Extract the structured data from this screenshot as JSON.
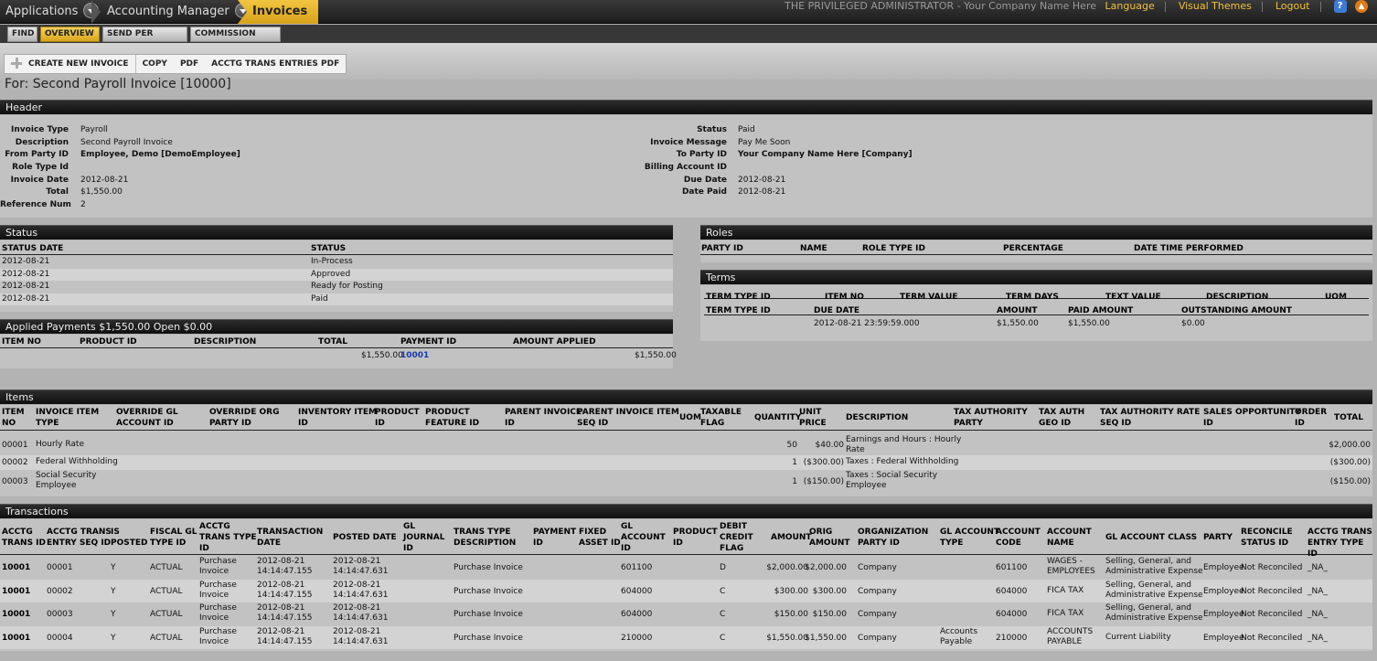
{
  "appbar": {
    "crumb1": "Applications",
    "crumb2": "Accounting Manager",
    "crumb3": "Invoices",
    "admin_text": "THE PRIVILEGED ADMINISTRATOR - Your Company Name Here",
    "language": "Language",
    "themes": "Visual Themes",
    "logout": "Logout",
    "help_icon": "?",
    "warn_icon": "▲"
  },
  "tabs": [
    "FIND",
    "OVERVIEW",
    "SEND PER EMAIL",
    "COMMISSION RUN"
  ],
  "actions": [
    "CREATE NEW INVOICE",
    "COPY",
    "PDF",
    "ACCTG TRANS ENTRIES PDF"
  ],
  "page_title": "For: Second Payroll Invoice [10000]",
  "header": {
    "title": "Header",
    "left": [
      {
        "label": "Invoice Type",
        "value": "Payroll"
      },
      {
        "label": "Description",
        "value": "Second Payroll Invoice"
      },
      {
        "label": "From Party ID",
        "value": "Employee, Demo [DemoEmployee]"
      },
      {
        "label": "Role Type Id",
        "value": ""
      },
      {
        "label": "Invoice Date",
        "value": "2012-08-21"
      },
      {
        "label": "Total",
        "value": "$1,550.00"
      },
      {
        "label": "Reference Num",
        "value": "2"
      }
    ],
    "right": [
      {
        "label": "Status",
        "value": "Paid"
      },
      {
        "label": "Invoice Message",
        "value": "Pay Me Soon"
      },
      {
        "label": "To Party ID",
        "value": "Your Company Name Here [Company]"
      },
      {
        "label": "Billing Account ID",
        "value": ""
      },
      {
        "label": "Due Date",
        "value": "2012-08-21"
      },
      {
        "label": "Date Paid",
        "value": "2012-08-21"
      }
    ]
  },
  "status": {
    "title": "Status",
    "col_date": "STATUS DATE",
    "col_status": "STATUS",
    "rows": [
      {
        "date": "2012-08-21",
        "status": "In-Process"
      },
      {
        "date": "2012-08-21",
        "status": "Approved"
      },
      {
        "date": "2012-08-21",
        "status": "Ready for Posting"
      },
      {
        "date": "2012-08-21",
        "status": "Paid"
      }
    ]
  },
  "applied": {
    "title": "Applied Payments $1,550.00 Open $0.00",
    "cols": [
      "ITEM NO",
      "PRODUCT ID",
      "DESCRIPTION",
      "TOTAL",
      "PAYMENT ID",
      "AMOUNT APPLIED"
    ],
    "row": {
      "total": "$1,550.00",
      "payment_id": "10001",
      "amount_applied": "$1,550.00"
    }
  },
  "roles": {
    "title": "Roles",
    "cols": [
      "PARTY ID",
      "NAME",
      "ROLE TYPE ID",
      "PERCENTAGE",
      "DATE TIME PERFORMED"
    ]
  },
  "terms": {
    "title": "Terms",
    "cols1": [
      "TERM TYPE ID",
      "ITEM NO",
      "TERM VALUE",
      "TERM DAYS",
      "TEXT VALUE",
      "DESCRIPTION",
      "UOM"
    ],
    "cols2": [
      "TERM TYPE ID",
      "DUE DATE",
      "AMOUNT",
      "PAID AMOUNT",
      "OUTSTANDING AMOUNT"
    ],
    "row": {
      "due_date": "2012-08-21 23:59:59.000",
      "amount": "$1,550.00",
      "paid": "$1,550.00",
      "outstanding": "$0.00"
    }
  },
  "items": {
    "title": "Items",
    "cols": [
      [
        "ITEM",
        "NO"
      ],
      [
        "INVOICE ITEM",
        "TYPE"
      ],
      [
        "OVERRIDE GL",
        "ACCOUNT ID"
      ],
      [
        "OVERRIDE ORG",
        "PARTY ID"
      ],
      [
        "INVENTORY ITEM",
        "ID"
      ],
      [
        "PRODUCT",
        "ID"
      ],
      [
        "PRODUCT",
        "FEATURE ID"
      ],
      [
        "PARENT INVOICE",
        "ID"
      ],
      [
        "PARENT INVOICE ITEM",
        "SEQ ID"
      ],
      [
        "UOM",
        ""
      ],
      [
        "TAXABLE",
        "FLAG"
      ],
      [
        "QUANTITY",
        ""
      ],
      [
        "UNIT",
        "PRICE"
      ],
      [
        "DESCRIPTION",
        ""
      ],
      [
        "TAX AUTHORITY",
        "PARTY"
      ],
      [
        "TAX AUTH",
        "GEO ID"
      ],
      [
        "TAX AUTHORITY RATE",
        "SEQ ID"
      ],
      [
        "SALES OPPORTUNITY",
        "ID"
      ],
      [
        "ORDER",
        "ID"
      ],
      [
        "TOTAL",
        ""
      ]
    ],
    "rows": [
      {
        "no": "00001",
        "type": [
          "Hourly Rate"
        ],
        "qty": "50",
        "price": "$40.00",
        "desc": [
          "Earnings and Hours : Hourly",
          "Rate"
        ],
        "total": "$2,000.00"
      },
      {
        "no": "00002",
        "type": [
          "Federal Withholding"
        ],
        "qty": "1",
        "price": "($300.00)",
        "desc": [
          "Taxes : Federal Withholding"
        ],
        "total": "($300.00)"
      },
      {
        "no": "00003",
        "type": [
          "Social Security",
          "Employee"
        ],
        "qty": "1",
        "price": "($150.00)",
        "desc": [
          "Taxes : Social Security",
          "Employee"
        ],
        "total": "($150.00)"
      }
    ]
  },
  "transactions": {
    "title": "Transactions",
    "cols": [
      [
        "ACCTG",
        "TRANS ID"
      ],
      [
        "ACCTG TRANS",
        "ENTRY SEQ ID"
      ],
      [
        "IS",
        "POSTED"
      ],
      [
        "FISCAL GL",
        "TYPE ID"
      ],
      [
        "ACCTG",
        "TRANS TYPE",
        "ID"
      ],
      [
        "TRANSACTION",
        "DATE"
      ],
      [
        "POSTED DATE"
      ],
      [
        "GL",
        "JOURNAL",
        "ID"
      ],
      [
        "TRANS TYPE",
        "DESCRIPTION"
      ],
      [
        "PAYMENT",
        "ID"
      ],
      [
        "FIXED",
        "ASSET ID"
      ],
      [
        "GL",
        "ACCOUNT",
        "ID"
      ],
      [
        "PRODUCT",
        "ID"
      ],
      [
        "DEBIT",
        "CREDIT",
        "FLAG"
      ],
      [
        "AMOUNT"
      ],
      [
        "ORIG",
        "AMOUNT"
      ],
      [
        "ORGANIZATION",
        "PARTY ID"
      ],
      [
        "GL ACCOUNT",
        "TYPE"
      ],
      [
        "ACCOUNT",
        "CODE"
      ],
      [
        "ACCOUNT",
        "NAME"
      ],
      [
        "GL ACCOUNT CLASS"
      ],
      [
        "PARTY"
      ],
      [
        "RECONCILE",
        "STATUS ID"
      ],
      [
        "ACCTG TRANS",
        "ENTRY TYPE ID"
      ]
    ],
    "rows": [
      {
        "trans_id": "10001",
        "seq": "00001",
        "posted": "Y",
        "fiscal": "ACTUAL",
        "ttype": [
          "Purchase",
          "Invoice"
        ],
        "tdate": [
          "2012-08-21",
          "14:14:47.155"
        ],
        "pdate": [
          "2012-08-21",
          "14:14:47.631"
        ],
        "desc": "Purchase Invoice",
        "gl_account": "601100",
        "flag": "D",
        "amount": "$2,000.00",
        "orig": "$2,000.00",
        "org": "Company",
        "gltype": [],
        "code": "601100",
        "name": [
          "WAGES -",
          "EMPLOYEES"
        ],
        "class": [
          "Selling, General, and",
          "Administrative Expense"
        ],
        "party": "Employee",
        "reconcile": "Not Reconciled",
        "entry_type": "_NA_"
      },
      {
        "trans_id": "10001",
        "seq": "00002",
        "posted": "Y",
        "fiscal": "ACTUAL",
        "ttype": [
          "Purchase",
          "Invoice"
        ],
        "tdate": [
          "2012-08-21",
          "14:14:47.155"
        ],
        "pdate": [
          "2012-08-21",
          "14:14:47.631"
        ],
        "desc": "Purchase Invoice",
        "gl_account": "604000",
        "flag": "C",
        "amount": "$300.00",
        "orig": "$300.00",
        "org": "Company",
        "gltype": [],
        "code": "604000",
        "name": [
          "FICA TAX"
        ],
        "class": [
          "Selling, General, and",
          "Administrative Expense"
        ],
        "party": "Employee",
        "reconcile": "Not Reconciled",
        "entry_type": "_NA_"
      },
      {
        "trans_id": "10001",
        "seq": "00003",
        "posted": "Y",
        "fiscal": "ACTUAL",
        "ttype": [
          "Purchase",
          "Invoice"
        ],
        "tdate": [
          "2012-08-21",
          "14:14:47.155"
        ],
        "pdate": [
          "2012-08-21",
          "14:14:47.631"
        ],
        "desc": "Purchase Invoice",
        "gl_account": "604000",
        "flag": "C",
        "amount": "$150.00",
        "orig": "$150.00",
        "org": "Company",
        "gltype": [],
        "code": "604000",
        "name": [
          "FICA TAX"
        ],
        "class": [
          "Selling, General, and",
          "Administrative Expense"
        ],
        "party": "Employee",
        "reconcile": "Not Reconciled",
        "entry_type": "_NA_"
      },
      {
        "trans_id": "10001",
        "seq": "00004",
        "posted": "Y",
        "fiscal": "ACTUAL",
        "ttype": [
          "Purchase",
          "Invoice"
        ],
        "tdate": [
          "2012-08-21",
          "14:14:47.155"
        ],
        "pdate": [
          "2012-08-21",
          "14:14:47.631"
        ],
        "desc": "Purchase Invoice",
        "gl_account": "210000",
        "flag": "C",
        "amount": "$1,550.00",
        "orig": "$1,550.00",
        "org": "Company",
        "gltype": [
          "Accounts",
          "Payable"
        ],
        "code": "210000",
        "name": [
          "ACCOUNTS",
          "PAYABLE"
        ],
        "class": [
          "Current Liability"
        ],
        "party": "Employee",
        "reconcile": "Not Reconciled",
        "entry_type": "_NA_"
      }
    ]
  }
}
